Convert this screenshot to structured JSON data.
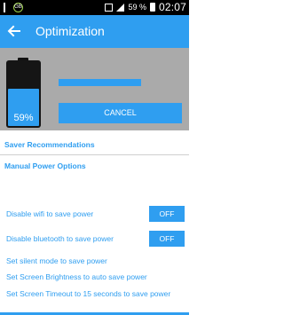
{
  "status_bar": {
    "battery_percent": "59 %",
    "clock": "02:07",
    "badge": "GB"
  },
  "app_bar": {
    "title": "Optimization"
  },
  "hero": {
    "battery_label": "59%",
    "battery_level": 0.59,
    "cancel_label": "CANCEL",
    "accent_color": "#2f9ef0"
  },
  "sections": {
    "saver_recommendations": "Saver Recommendations",
    "manual_power_options": "Manual Power Options"
  },
  "options": [
    {
      "label": "Disable wifi to save power",
      "toggle": "OFF"
    },
    {
      "label": "Disable bluetooth to save power",
      "toggle": "OFF"
    },
    {
      "label": "Set silent mode to save power"
    },
    {
      "label": "Set Screen Brightness to auto save power"
    },
    {
      "label": "Set Screen Timeout to 15 seconds to save power"
    }
  ]
}
